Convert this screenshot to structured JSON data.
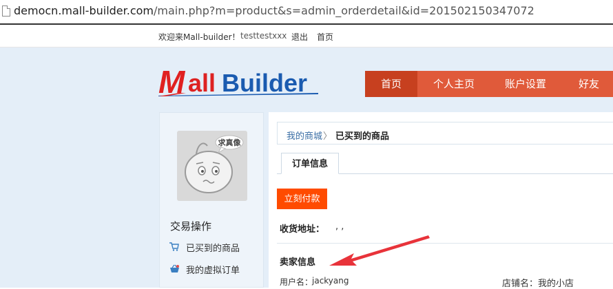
{
  "browser": {
    "url_host": "democn.mall-builder.com",
    "url_path": "/main.php?m=product&s=admin_orderdetail&id=201502150347072"
  },
  "toplinks": {
    "welcome": "欢迎来Mall-builder！",
    "username": "testtestxxx",
    "logout": "退出",
    "home": "首页"
  },
  "logo": {
    "m": "M",
    "all": "all",
    "builder": "Builder"
  },
  "nav": {
    "items": [
      "首页",
      "个人主页",
      "账户设置",
      "好友"
    ],
    "active_index": 0
  },
  "sidebar": {
    "avatar_text": "求真像",
    "section_title": "交易操作",
    "items": [
      {
        "label": "已买到的商品",
        "icon": "cart-icon"
      },
      {
        "label": "我的虚拟订单",
        "icon": "basket-icon"
      }
    ]
  },
  "breadcrumb": {
    "root": "我的商城",
    "separator": "〉",
    "current": "已买到的商品"
  },
  "tabs": {
    "order_info": "订单信息"
  },
  "actions": {
    "pay_now": "立刻付款"
  },
  "order": {
    "shipping_label": "收货地址：",
    "shipping_value": ", ,"
  },
  "seller": {
    "title": "卖家信息",
    "user_label": "用户名：",
    "user_value": "jackyang",
    "shop_label": "店铺名：",
    "shop_value": "我的小店"
  },
  "colors": {
    "nav_bg": "#e05a3a",
    "nav_active": "#c7401f",
    "pay_button": "#ff4b00",
    "logo_red": "#e02020",
    "logo_blue": "#1a5bb0",
    "page_bg": "#e4eef8",
    "annotation_arrow": "#e8333a"
  }
}
